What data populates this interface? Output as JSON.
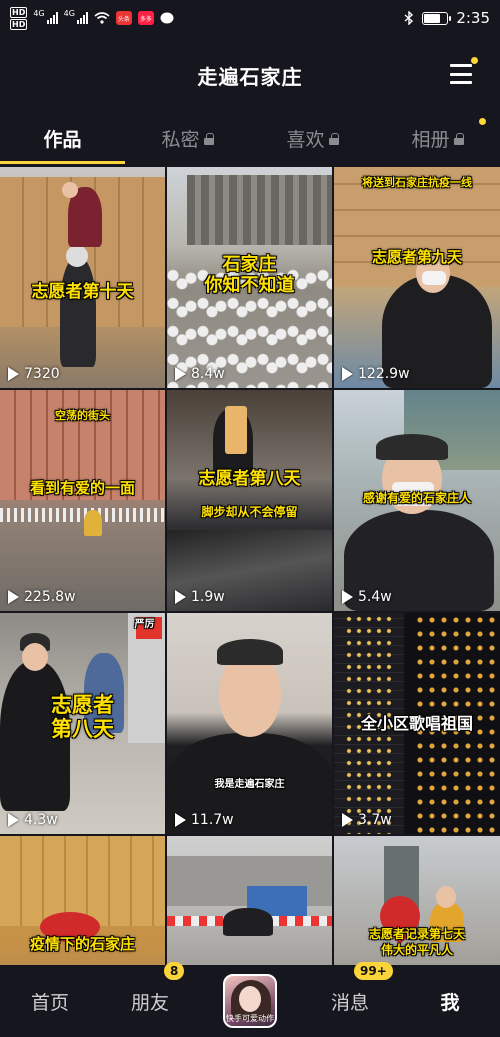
{
  "status_bar": {
    "time": "2:35",
    "net_labels": [
      "4G",
      "4G"
    ],
    "app_badge_1": "头条",
    "app_badge_2": "多多",
    "icons": [
      "hd-icon",
      "signal-icon",
      "wifi-icon",
      "bluetooth-icon",
      "battery-icon"
    ],
    "battery_level": 0.7
  },
  "header": {
    "title": "走遍石家庄",
    "menu_icon": "hamburger-menu-icon"
  },
  "tabs": [
    {
      "label": "作品",
      "locked": false,
      "active": true
    },
    {
      "label": "私密",
      "locked": true,
      "active": false
    },
    {
      "label": "喜欢",
      "locked": true,
      "active": false
    },
    {
      "label": "相册",
      "locked": true,
      "active": false
    }
  ],
  "videos": [
    {
      "caption": "志愿者第十天",
      "sub": "",
      "plays": "7320"
    },
    {
      "caption": "石家庄\n你知不知道",
      "sub": "",
      "plays": "8.4w"
    },
    {
      "caption": "志愿者第九天",
      "sub": "将送到石家庄抗疫一线",
      "plays": "122.9w"
    },
    {
      "caption": "看到有爱的一面",
      "sub": "空荡的街头",
      "plays": "225.8w"
    },
    {
      "caption": "志愿者第八天",
      "sub": "脚步却从不会停留",
      "plays": "1.9w"
    },
    {
      "caption": "感谢有爱的石家庄人",
      "sub": "",
      "plays": "5.4w"
    },
    {
      "caption": "志愿者\n第八天",
      "sub": "严厉",
      "plays": "4.3w"
    },
    {
      "caption": "我是走遍石家庄",
      "sub": "",
      "plays": "11.7w"
    },
    {
      "caption": "全小区歌唱祖国",
      "sub": "",
      "plays": "3.7w"
    },
    {
      "caption": "疫情下的石家庄",
      "sub": "",
      "plays": ""
    },
    {
      "caption": "",
      "sub": "",
      "plays": ""
    },
    {
      "caption": "志愿者记录第七天",
      "sub": "伟大的平凡人",
      "plays": ""
    }
  ],
  "bottom_nav": {
    "home": "首页",
    "friends": "朋友",
    "friends_badge": "8",
    "center_label": "快手可爱动作",
    "messages": "消息",
    "messages_badge": "99+",
    "me": "我"
  }
}
